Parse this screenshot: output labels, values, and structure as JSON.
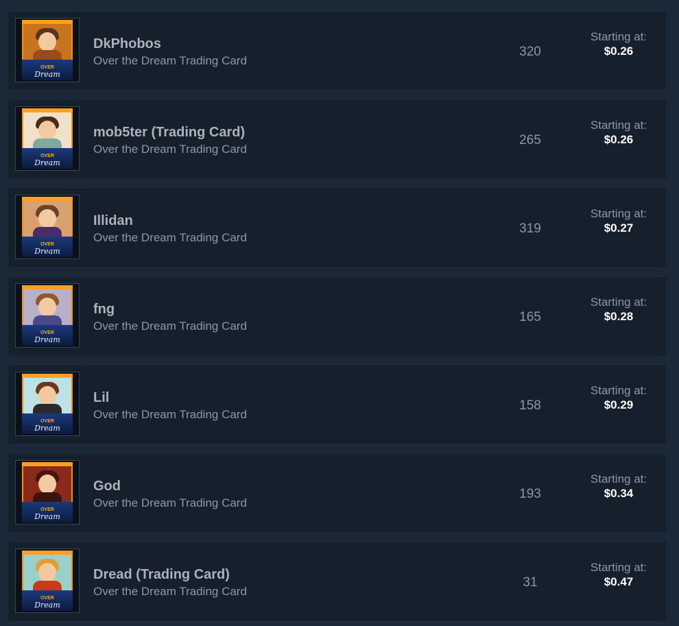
{
  "listings": [
    {
      "name": "DkPhobos",
      "game": "Over the Dream Trading Card",
      "quantity": "320",
      "price_label": "Starting at:",
      "price": "$0.26",
      "art": {
        "bg": "#c8741e",
        "hair": "#5a3418",
        "body": "#9b4a1c"
      }
    },
    {
      "name": "mob5ter (Trading Card)",
      "game": "Over the Dream Trading Card",
      "quantity": "265",
      "price_label": "Starting at:",
      "price": "$0.26",
      "art": {
        "bg": "#f0e2c8",
        "hair": "#4a2a1a",
        "body": "#7fa8a0"
      }
    },
    {
      "name": "Illidan",
      "game": "Over the Dream Trading Card",
      "quantity": "319",
      "price_label": "Starting at:",
      "price": "$0.27",
      "art": {
        "bg": "#d9a070",
        "hair": "#6a4428",
        "body": "#4a2c6a"
      }
    },
    {
      "name": "fng",
      "game": "Over the Dream Trading Card",
      "quantity": "165",
      "price_label": "Starting at:",
      "price": "$0.28",
      "art": {
        "bg": "#b8b0c8",
        "hair": "#8a5a30",
        "body": "#4a4a8a"
      }
    },
    {
      "name": "Lil",
      "game": "Over the Dream Trading Card",
      "quantity": "158",
      "price_label": "Starting at:",
      "price": "$0.29",
      "art": {
        "bg": "#bde2e6",
        "hair": "#6a3a18",
        "body": "#2a2a2a"
      }
    },
    {
      "name": "God",
      "game": "Over the Dream Trading Card",
      "quantity": "193",
      "price_label": "Starting at:",
      "price": "$0.34",
      "art": {
        "bg": "#8a2a1a",
        "hair": "#4a1410",
        "body": "#3a1410"
      }
    },
    {
      "name": "Dread (Trading Card)",
      "game": "Over the Dream Trading Card",
      "quantity": "31",
      "price_label": "Starting at:",
      "price": "$0.47",
      "art": {
        "bg": "#9ad0c8",
        "hair": "#e0a030",
        "body": "#c83a1a"
      }
    }
  ],
  "card_logo": {
    "over": "OVER",
    "script": "Dream"
  },
  "colors": {
    "page_bg": "#1b2838",
    "row_bg": "#16202d",
    "name_text": "#acb2b8",
    "sub_text": "#8f98a0",
    "price_text": "#ffffff",
    "card_border": "#f0901c"
  }
}
